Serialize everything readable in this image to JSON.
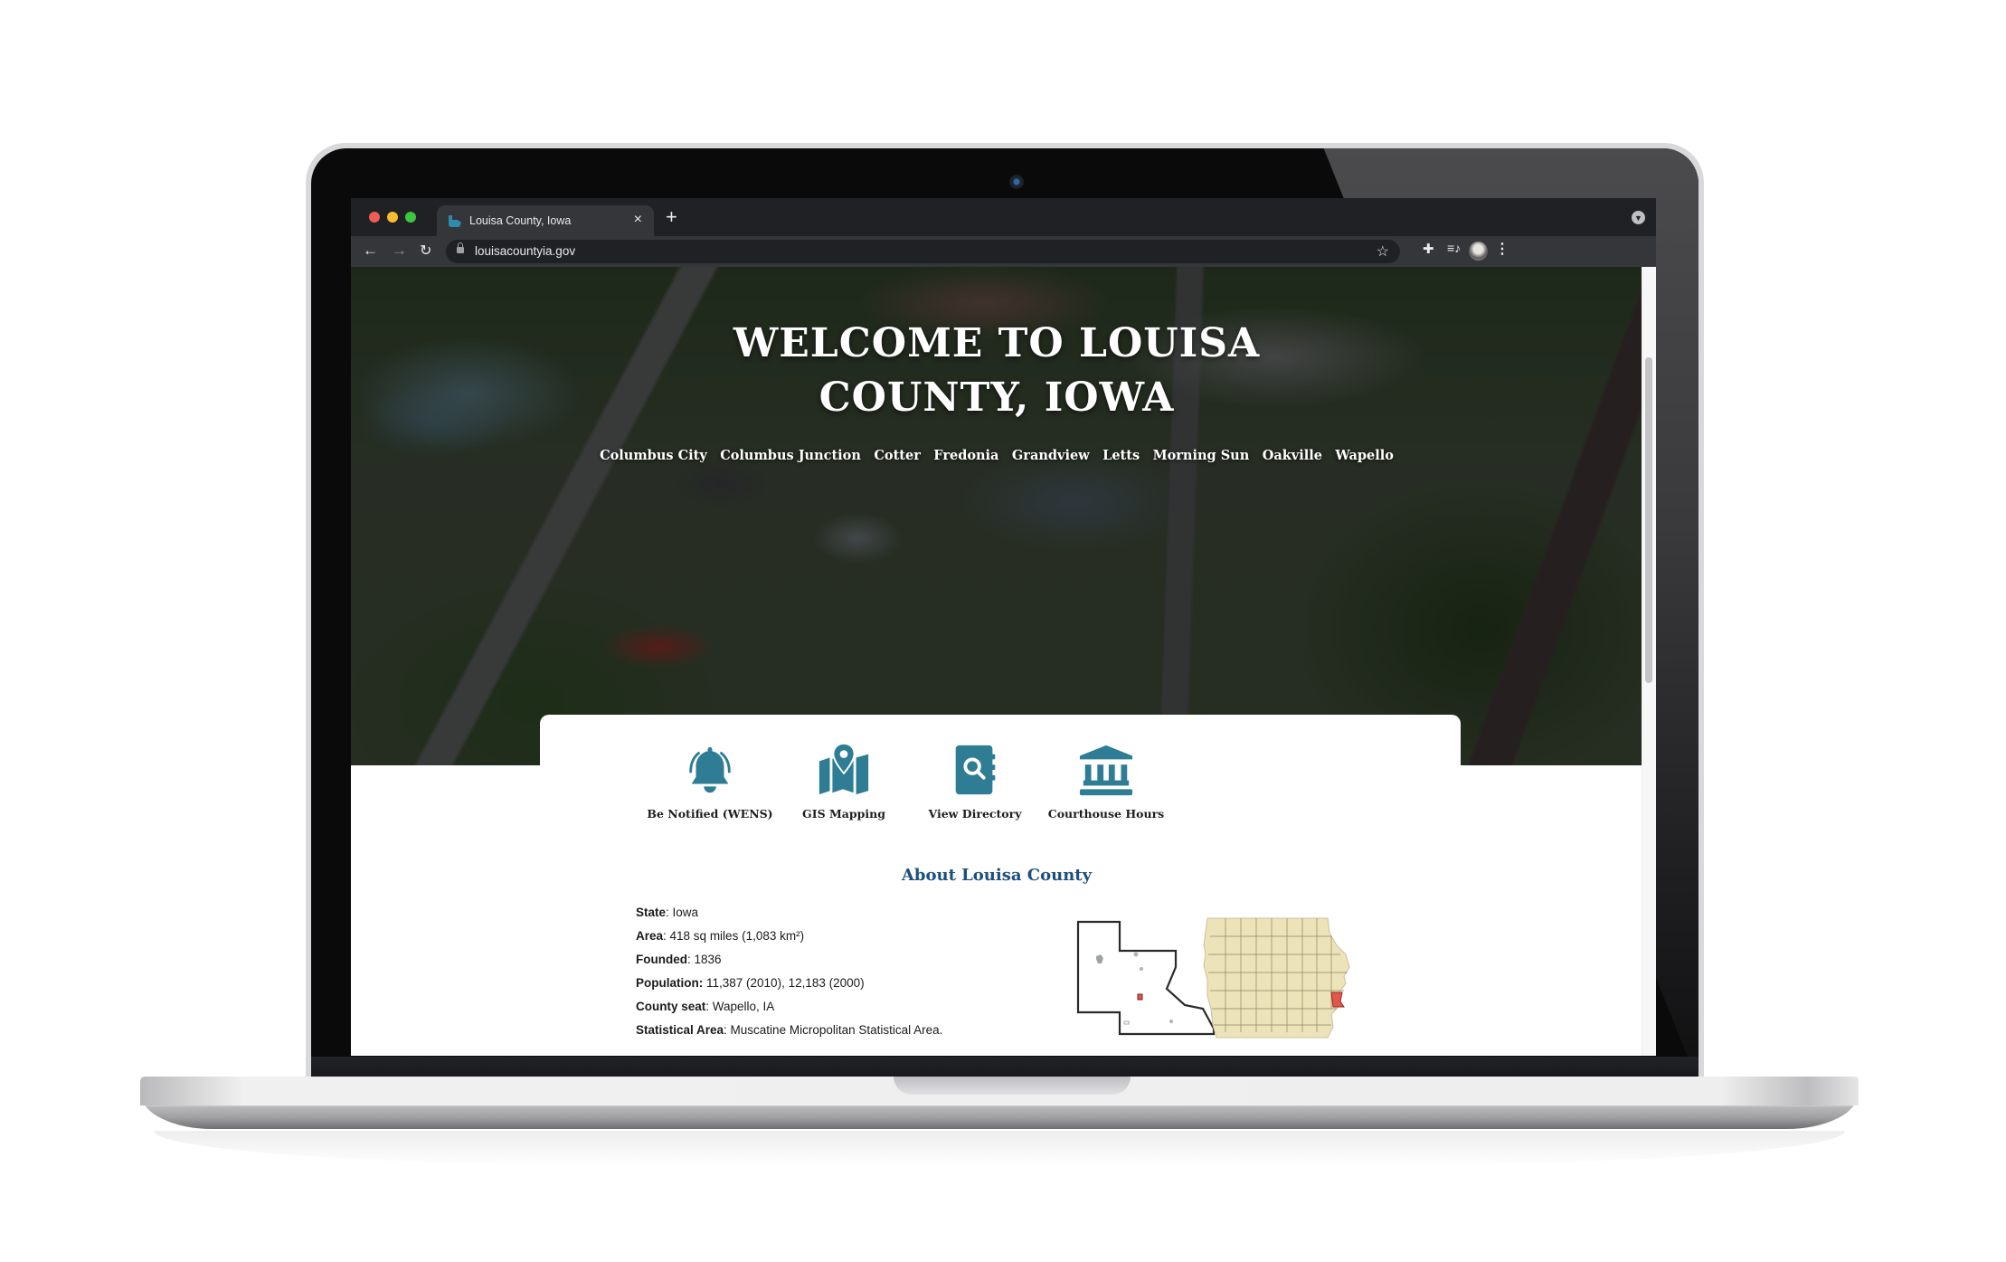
{
  "browser": {
    "tab_title": "Louisa County, Iowa",
    "tab_close_icon": "×",
    "new_tab_icon": "+",
    "url": "louisacountyia.gov",
    "icons": [
      "back-arrow-icon",
      "forward-arrow-icon",
      "reload-icon",
      "lock-icon",
      "star-icon",
      "extensions-puzzle-icon",
      "media-queue-icon",
      "profile-avatar",
      "kebab-menu-icon",
      "tab-search-icon"
    ]
  },
  "hero": {
    "title_line1": "WELCOME TO LOUISA",
    "title_line2": "COUNTY, IOWA",
    "towns": [
      "Columbus City",
      "Columbus Junction",
      "Cotter",
      "Fredonia",
      "Grandview",
      "Letts",
      "Morning Sun",
      "Oakville",
      "Wapello"
    ]
  },
  "quick_links": [
    {
      "label": "Be Notified (WENS)",
      "icon": "bell-icon"
    },
    {
      "label": "GIS Mapping",
      "icon": "map-pin-icon"
    },
    {
      "label": "View Directory",
      "icon": "directory-search-icon"
    },
    {
      "label": "Courthouse Hours",
      "icon": "courthouse-icon"
    }
  ],
  "about": {
    "title": "About Louisa County",
    "facts": [
      {
        "label": "State",
        "value": ": Iowa"
      },
      {
        "label": "Area",
        "value": ": 418 sq miles (1,083 km²)"
      },
      {
        "label": "Founded",
        "value": ": 1836"
      },
      {
        "label": "Population:",
        "value": " 11,387 (2010), 12,183 (2000)"
      },
      {
        "label": "County seat",
        "value": ": Wapello, IA"
      },
      {
        "label": "Statistical Area",
        "value": ": Muscatine Micropolitan Statistical Area."
      }
    ]
  },
  "colors": {
    "accent_teal": "#2e7d95",
    "heading_blue": "#1d4f7e",
    "map_fill": "#ede3b8",
    "highlight_red": "#e0574b"
  }
}
